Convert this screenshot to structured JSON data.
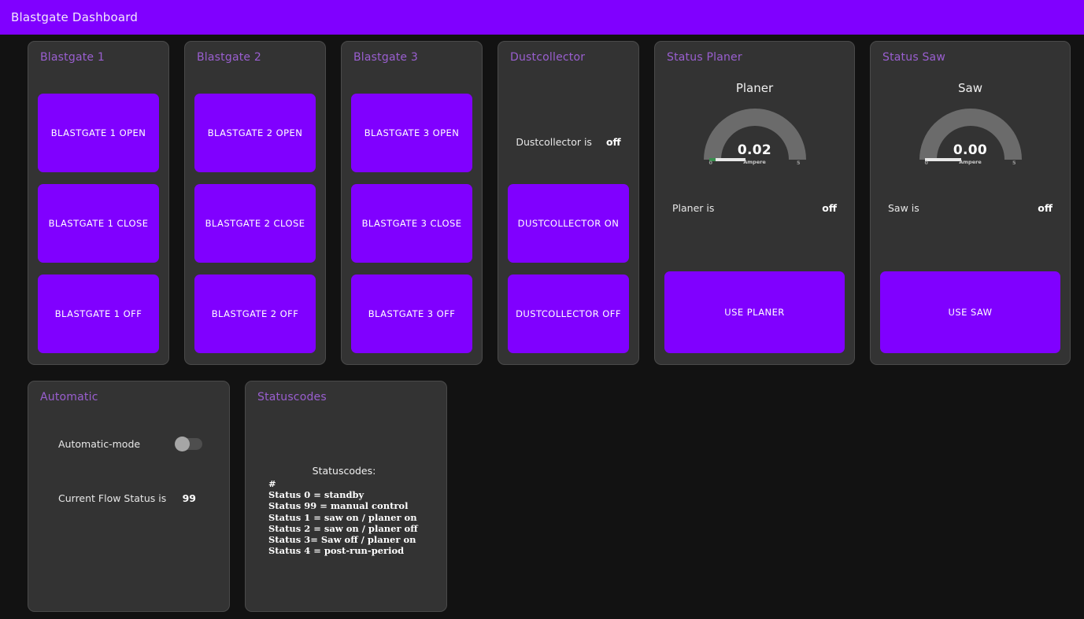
{
  "header": {
    "title": "Blastgate Dashboard"
  },
  "colors": {
    "accent": "#8000ff",
    "card_bg": "#333333",
    "page_bg": "#121212",
    "card_title": "#9a5fd0",
    "gauge_track": "#6b6b6b",
    "gauge_bar": "#e8e8e8",
    "gauge_bar_green": "#3a8f4f"
  },
  "blastgates": [
    {
      "title": "Blastgate 1",
      "buttons": [
        {
          "label": "BLASTGATE 1 OPEN",
          "name": "blastgate-1-open-button"
        },
        {
          "label": "BLASTGATE 1 CLOSE",
          "name": "blastgate-1-close-button"
        },
        {
          "label": "BLASTGATE 1 OFF",
          "name": "blastgate-1-off-button"
        }
      ]
    },
    {
      "title": "Blastgate 2",
      "buttons": [
        {
          "label": "BLASTGATE 2 OPEN",
          "name": "blastgate-2-open-button"
        },
        {
          "label": "BLASTGATE 2 CLOSE",
          "name": "blastgate-2-close-button"
        },
        {
          "label": "BLASTGATE 2 OFF",
          "name": "blastgate-2-off-button"
        }
      ]
    },
    {
      "title": "Blastgate 3",
      "buttons": [
        {
          "label": "BLASTGATE 3 OPEN",
          "name": "blastgate-3-open-button"
        },
        {
          "label": "BLASTGATE 3 CLOSE",
          "name": "blastgate-3-close-button"
        },
        {
          "label": "BLASTGATE 3 OFF",
          "name": "blastgate-3-off-button"
        }
      ]
    }
  ],
  "dustcollector": {
    "title": "Dustcollector",
    "status_label": "Dustcollector is",
    "status_value": "off",
    "on_button": "DUSTCOLLECTOR ON",
    "off_button": "DUSTCOLLECTOR OFF"
  },
  "status_planer": {
    "title": "Status Planer",
    "gauge_name": "Planer",
    "gauge_value": "0.02",
    "gauge_unit": "Ampere",
    "gauge_min": "0",
    "gauge_max": "5",
    "status_label": "Planer is",
    "status_value": "off",
    "action_button": "USE PLANER"
  },
  "status_saw": {
    "title": "Status Saw",
    "gauge_name": "Saw",
    "gauge_value": "0.00",
    "gauge_unit": "Ampere",
    "gauge_min": "0",
    "gauge_max": "5",
    "status_label": "Saw is",
    "status_value": "off",
    "action_button": "USE SAW"
  },
  "automatic": {
    "title": "Automatic",
    "mode_label": "Automatic-mode",
    "mode_state": "off",
    "flow_label": "Current Flow Status is",
    "flow_value": "99"
  },
  "statuscodes": {
    "title": "Statuscodes",
    "heading": "Statuscodes:",
    "lines": [
      "#",
      "Status 0 = standby",
      "Status 99 = manual control",
      "Status 1 = saw on / planer on",
      "Status 2 = saw on / planer off",
      "Status 3= Saw off / planer on",
      "Status 4 = post-run-period"
    ]
  }
}
